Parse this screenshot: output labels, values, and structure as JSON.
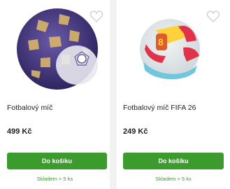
{
  "products": [
    {
      "title": "Fotbalový míč",
      "price": "499 Kč",
      "button_label": "Do košíku",
      "stock": "Skladem > 5 ks",
      "image_icon": "football-purple-gold-icon",
      "favorite_icon": "heart-outline-icon"
    },
    {
      "title": "Fotbalový míč FIFA 26",
      "price": "249 Kč",
      "button_label": "Do košíku",
      "stock": "Skladem > 5 ks",
      "image_icon": "football-colorful-icon",
      "favorite_icon": "heart-outline-icon"
    }
  ],
  "colors": {
    "accent": "#3b9b2c",
    "background": "#f2f2f2"
  }
}
